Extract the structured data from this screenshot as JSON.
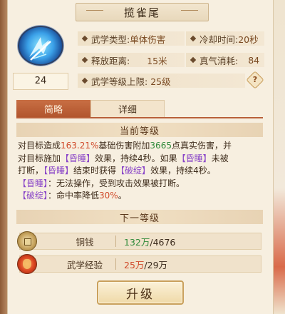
{
  "title": "揽雀尾",
  "skill": {
    "icon": "sword-slash-icon",
    "level": "24"
  },
  "info": {
    "type_label": "武学类型:",
    "type_value": "单体伤害",
    "cooldown_label": "冷却时间:",
    "cooldown_value": "20秒",
    "range_label": "释放距离:",
    "range_value": "15米",
    "energy_label": "真气消耗:",
    "energy_value": "84",
    "level_cap_label": "武学等级上限:",
    "level_cap_value": "25级",
    "help": "?"
  },
  "tabs": [
    {
      "label": "简略"
    },
    {
      "label": "详细"
    }
  ],
  "current_level": {
    "header": "当前等级",
    "desc": {
      "s1": "对目标造成",
      "pct": "163.21%",
      "s2": "基础伤害附加",
      "dmg": "3665",
      "s3": "点真实伤害，并",
      "s4": "对目标施加",
      "tag1": "【昏睡】",
      "s5": "效果，持续4秒。如果",
      "tag2": "【昏睡】",
      "s6": "未被",
      "s7": "打断，",
      "tag3": "【昏睡】",
      "s8": "结束时获得",
      "tag4": "【破绽】",
      "s9": "效果，持续4秒。",
      "tag5": "【昏睡】",
      "s10": "：无法操作，受到攻击效果被打断。",
      "tag6": "【破绽】",
      "s11": "：命中率降低",
      "hitpct": "30%",
      "s12": "。"
    }
  },
  "next_level": {
    "header": "下一等级"
  },
  "costs": [
    {
      "icon": "coin-icon",
      "name": "铜钱",
      "have": "132万",
      "need": "/4676"
    },
    {
      "icon": "martial-xp-icon",
      "name": "武学经验",
      "have": "25万",
      "need": "/29万"
    }
  ],
  "upgrade_button": "升级",
  "colors": {
    "accent": "#b9603a",
    "positive": "#2f8a3a",
    "highlight": "#d04a2a",
    "status_tag": "#8a46c8"
  }
}
